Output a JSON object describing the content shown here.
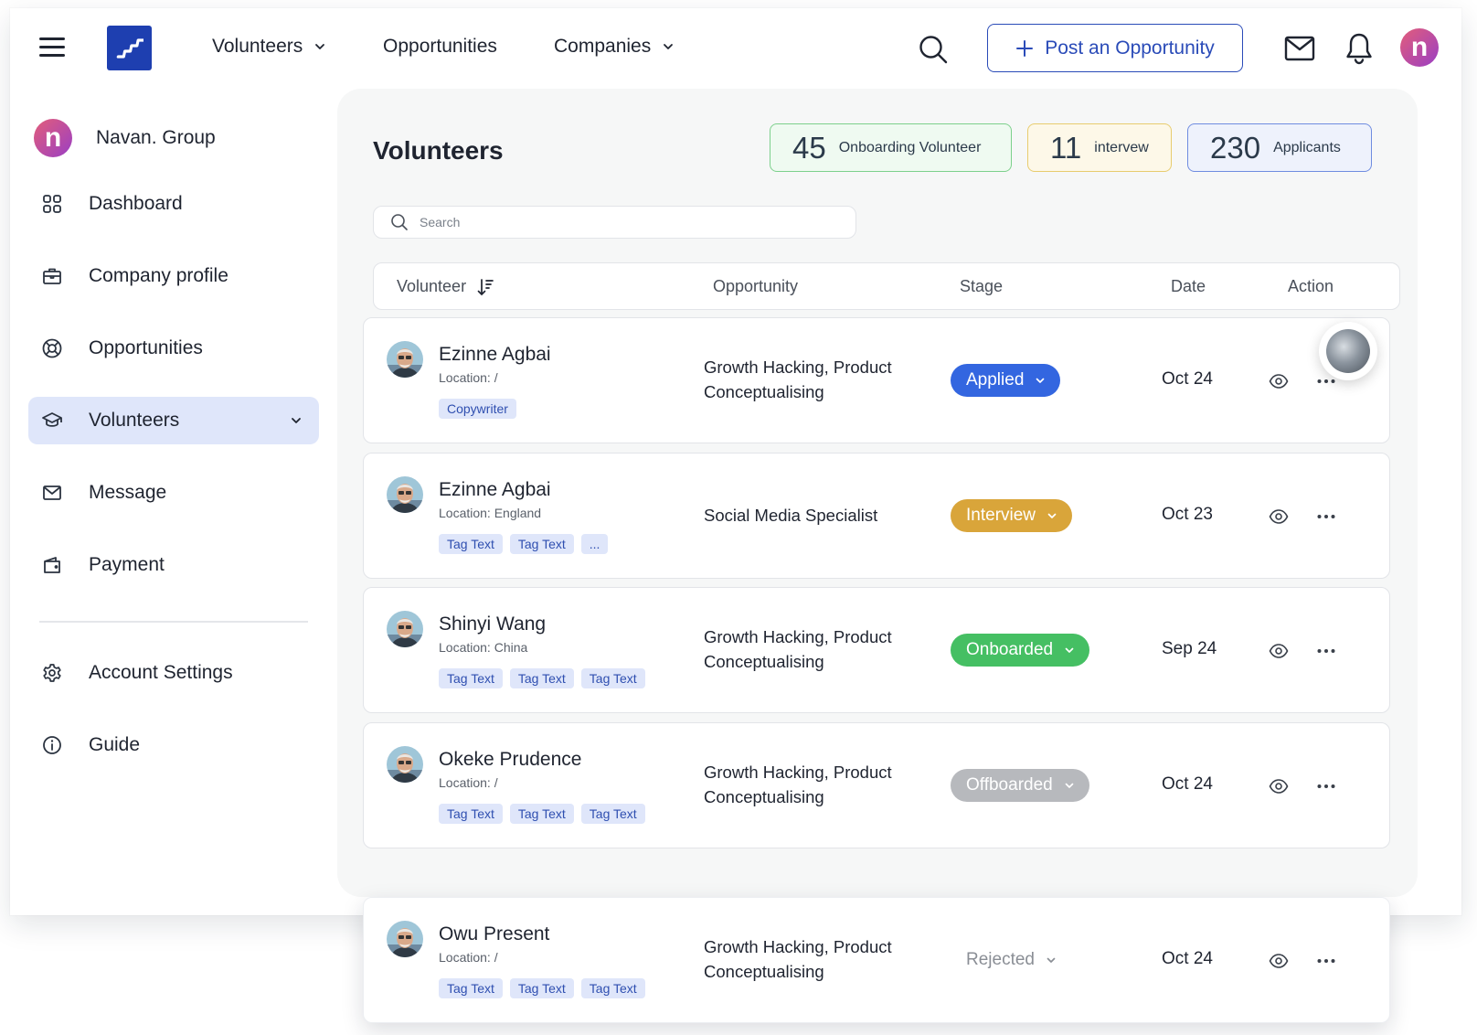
{
  "nav": {
    "volunteers": "Volunteers",
    "opportunities": "Opportunities",
    "companies": "Companies",
    "post_button": "Post an Opportunity",
    "user_initial": "n"
  },
  "sidebar": {
    "org_name": "Navan. Group",
    "org_initial": "n",
    "items": [
      {
        "label": "Dashboard",
        "icon": "grid-icon"
      },
      {
        "label": "Company profile",
        "icon": "briefcase-icon"
      },
      {
        "label": "Opportunities",
        "icon": "lifebuoy-icon"
      },
      {
        "label": "Volunteers",
        "icon": "graduation-cap-icon",
        "active": true
      },
      {
        "label": "Message",
        "icon": "mail-icon"
      },
      {
        "label": "Payment",
        "icon": "wallet-icon"
      }
    ],
    "bottom_items": [
      {
        "label": "Account Settings",
        "icon": "gear-icon"
      },
      {
        "label": "Guide",
        "icon": "info-icon"
      }
    ]
  },
  "main": {
    "title": "Volunteers",
    "stats": [
      {
        "value": "45",
        "label": "Onboarding Volunteer",
        "color": "#7dd08c"
      },
      {
        "value": "11",
        "label": "intervew",
        "color": "#e8cc6e"
      },
      {
        "value": "230",
        "label": "Applicants",
        "color": "#6f8ce0"
      }
    ],
    "search_placeholder": "Search",
    "columns": {
      "volunteer": "Volunteer",
      "opportunity": "Opportunity",
      "stage": "Stage",
      "date": "Date",
      "action": "Action"
    },
    "rows": [
      {
        "name": "Ezinne Agbai",
        "location": "Location: /",
        "tags": [
          "Copywriter"
        ],
        "opportunity_1": "Growth Hacking, Product",
        "opportunity_2": "Conceptualising",
        "stage": "Applied",
        "date": "Oct 24"
      },
      {
        "name": "Ezinne Agbai",
        "location": "Location: England",
        "tags": [
          "Tag Text",
          "Tag Text",
          "..."
        ],
        "opportunity_1": "Social Media Specialist",
        "opportunity_2": "",
        "stage": "Interview",
        "date": "Oct 23"
      },
      {
        "name": "Shinyi Wang",
        "location": "Location: China",
        "tags": [
          "Tag Text",
          "Tag Text",
          "Tag Text"
        ],
        "opportunity_1": "Growth Hacking, Product",
        "opportunity_2": "Conceptualising",
        "stage": "Onboarded",
        "date": "Sep 24"
      },
      {
        "name": "Okeke Prudence",
        "location": "Location: /",
        "tags": [
          "Tag Text",
          "Tag Text",
          "Tag Text"
        ],
        "opportunity_1": "Growth Hacking, Product",
        "opportunity_2": "Conceptualising",
        "stage": "Offboarded",
        "date": "Oct 24"
      },
      {
        "name": "Owu Present",
        "location": "Location: /",
        "tags": [
          "Tag Text",
          "Tag Text",
          "Tag Text"
        ],
        "opportunity_1": "Growth Hacking, Product",
        "opportunity_2": "Conceptualising",
        "stage": "Rejected",
        "date": "Oct 24"
      }
    ]
  },
  "colors": {
    "brand": "#1e3fb0",
    "applied": "#3366e0",
    "interview": "#d9a53a",
    "onboarded": "#45bf63",
    "offboarded": "#b7b9bd",
    "tag_bg": "#dfe6fa"
  }
}
